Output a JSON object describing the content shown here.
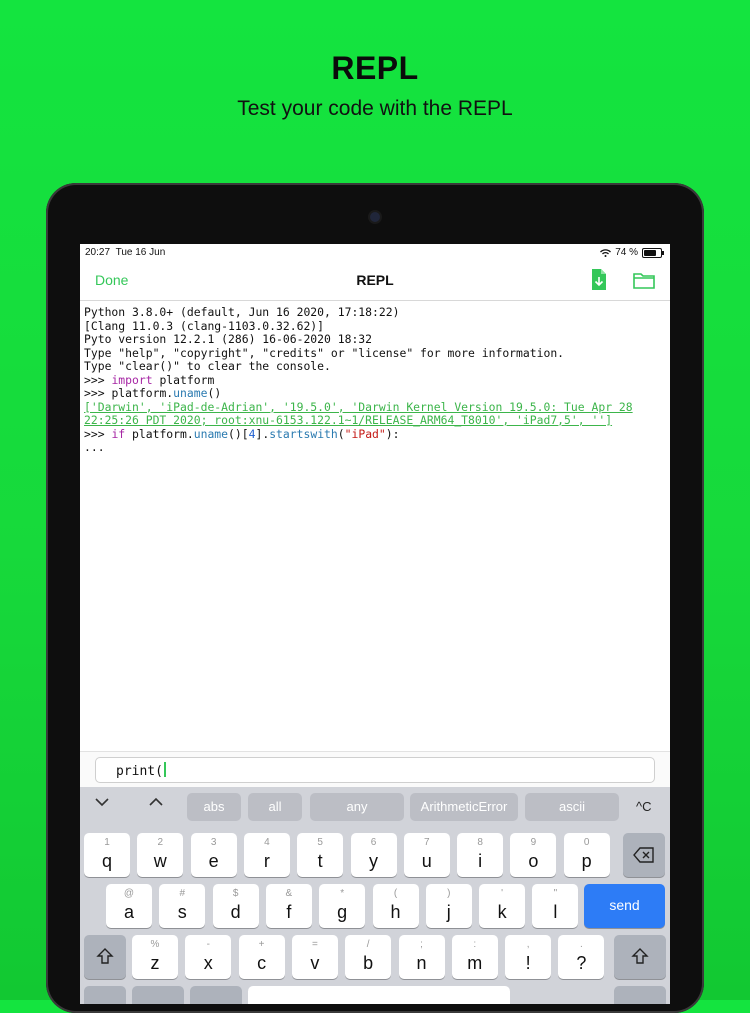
{
  "hero": {
    "title": "REPL",
    "subtitle": "Test your code with the REPL"
  },
  "status_bar": {
    "time": "20:27",
    "date": "Tue 16 Jun",
    "battery": "74 %"
  },
  "nav": {
    "done": "Done",
    "title": "REPL"
  },
  "console": {
    "banner": [
      "Python 3.8.0+ (default, Jun 16 2020, 17:18:22)",
      "[Clang 11.0.3 (clang-1103.0.32.62)]",
      "Pyto version 12.2.1 (286) 16-06-2020 18:32",
      "Type \"help\", \"copyright\", \"credits\" or \"license\" for more information.",
      "Type \"clear()\" to clear the console."
    ],
    "prompt": ">>> ",
    "cmd1_kw": "import",
    "cmd1_rest": " platform",
    "cmd2_a": "platform.",
    "cmd2_fn": "uname",
    "cmd2_b": "()",
    "output1": "['Darwin', 'iPad-de-Adrian', '19.5.0', 'Darwin Kernel Version 19.5.0: Tue Apr 28",
    "output2": "22:25:26 PDT 2020; root:xnu-6153.122.1~1/RELEASE_ARM64_T8010', 'iPad7,5', '']",
    "cmd3_kw": "if",
    "cmd3_a": " platform.",
    "cmd3_fn": "uname",
    "cmd3_b": "()[",
    "cmd3_num": "4",
    "cmd3_c": "].",
    "cmd3_fn2": "startswith",
    "cmd3_d": "(",
    "cmd3_str": "\"iPad\"",
    "cmd3_e": "):",
    "continuation": "..."
  },
  "input": {
    "value": "print("
  },
  "suggestions": [
    "abs",
    "all",
    "any",
    "ArithmeticError",
    "ascii"
  ],
  "ctrl_c": "^C",
  "keys": {
    "row1": [
      {
        "c": "q",
        "s": "1"
      },
      {
        "c": "w",
        "s": "2"
      },
      {
        "c": "e",
        "s": "3"
      },
      {
        "c": "r",
        "s": "4"
      },
      {
        "c": "t",
        "s": "5"
      },
      {
        "c": "y",
        "s": "6"
      },
      {
        "c": "u",
        "s": "7"
      },
      {
        "c": "i",
        "s": "8"
      },
      {
        "c": "o",
        "s": "9"
      },
      {
        "c": "p",
        "s": "0"
      }
    ],
    "row2": [
      {
        "c": "a",
        "s": "@"
      },
      {
        "c": "s",
        "s": "#"
      },
      {
        "c": "d",
        "s": "$"
      },
      {
        "c": "f",
        "s": "&"
      },
      {
        "c": "g",
        "s": "*"
      },
      {
        "c": "h",
        "s": "("
      },
      {
        "c": "j",
        "s": ")"
      },
      {
        "c": "k",
        "s": "'"
      },
      {
        "c": "l",
        "s": "\""
      }
    ],
    "row3": [
      {
        "c": "z",
        "s": "%"
      },
      {
        "c": "x",
        "s": "-"
      },
      {
        "c": "c",
        "s": "+"
      },
      {
        "c": "v",
        "s": "="
      },
      {
        "c": "b",
        "s": "/"
      },
      {
        "c": "n",
        "s": ";"
      },
      {
        "c": "m",
        "s": ":"
      },
      {
        "c": "!",
        "s": ","
      },
      {
        "c": "?",
        "s": "."
      }
    ],
    "send": "send"
  },
  "icons": {
    "download": "download-doc-icon",
    "folder": "folder-icon",
    "wifi": "wifi-icon",
    "backspace": "backspace-icon",
    "shift": "shift-icon"
  },
  "colors": {
    "accent": "#34c759",
    "background": "#14e43f",
    "send": "#2d7cf6"
  }
}
